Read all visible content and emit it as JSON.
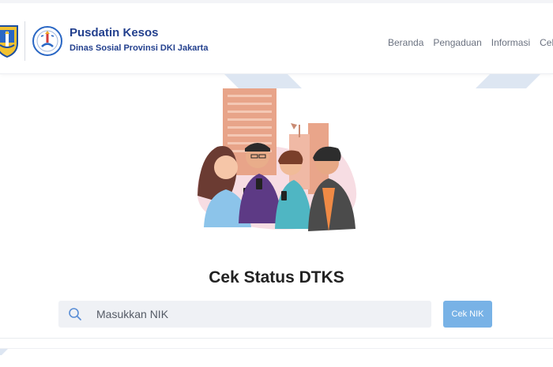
{
  "brand": {
    "title": "Pusdatin Kesos",
    "subtitle": "Dinas Sosial Provinsi DKI Jakarta",
    "logo_left_icon": "dki-jakarta-crest-icon",
    "logo_right_icon": "dinas-sosial-emblem-icon",
    "color": "#23408e"
  },
  "nav": {
    "items": [
      {
        "label": "Beranda"
      },
      {
        "label": "Pengaduan"
      },
      {
        "label": "Informasi"
      },
      {
        "label": "Cek T"
      }
    ]
  },
  "hero": {
    "illustration": "people-with-phones-city-illustration"
  },
  "cek": {
    "title": "Cek Status DTKS",
    "placeholder": "Masukkan NIK",
    "button_label": "Cek NIK",
    "search_icon": "search-icon",
    "button_color": "#78b2e6"
  }
}
